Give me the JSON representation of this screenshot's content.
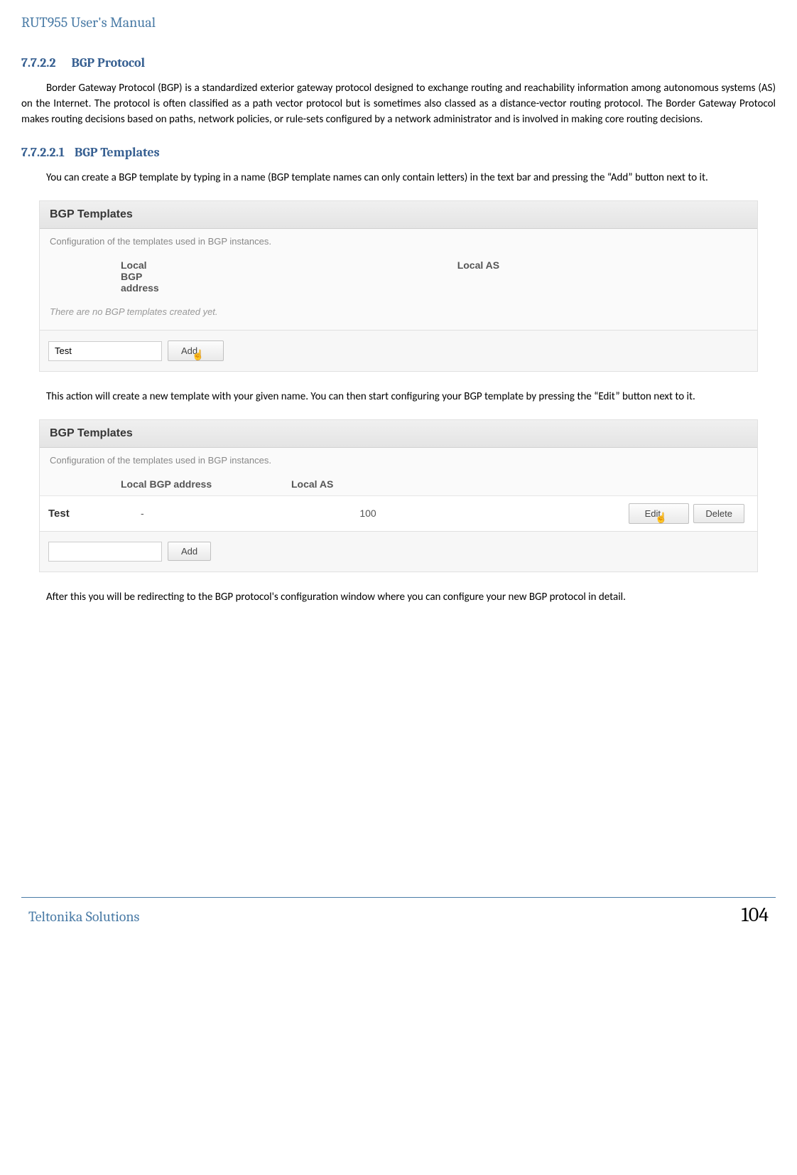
{
  "header": {
    "title": "RUT955 User's Manual"
  },
  "section1": {
    "num": "7.7.2.2",
    "title": "BGP Protocol",
    "body": "Border Gateway Protocol (BGP) is a standardized exterior gateway protocol designed to exchange routing and reachability information among autonomous systems (AS) on the Internet. The protocol is often classified as a path vector protocol but is sometimes also classed as a distance-vector routing protocol. The Border Gateway Protocol makes routing decisions based on paths, network policies, or rule-sets configured by a network administrator and is involved in making core routing decisions."
  },
  "section2": {
    "num": "7.7.2.2.1",
    "title": "BGP Templates",
    "body1": "You can create a BGP template by typing in a name (BGP template names can only contain letters) in the text bar and pressing the “Add” button next to it.",
    "body2": "This action will create a new template with your given name. You can then start configuring your BGP template by pressing the “Edit” button next to it.",
    "body3": "After this you will be redirecting to the BGP protocol's configuration window where you can configure your new BGP protocol in detail."
  },
  "panel1": {
    "title": "BGP Templates",
    "desc": "Configuration of the templates used in BGP instances.",
    "col_addr": "Local BGP address",
    "col_as": "Local AS",
    "empty": "There are no BGP templates created yet.",
    "input_value": "Test",
    "add_btn": "Add"
  },
  "panel2": {
    "title": "BGP Templates",
    "desc": "Configuration of the templates used in BGP instances.",
    "col_addr": "Local BGP address",
    "col_as": "Local AS",
    "row": {
      "name": "Test",
      "addr": "-",
      "as": "100"
    },
    "edit_btn": "Edit",
    "delete_btn": "Delete",
    "input_value": "",
    "add_btn": "Add"
  },
  "footer": {
    "left": "Teltonika Solutions",
    "right": "104"
  }
}
